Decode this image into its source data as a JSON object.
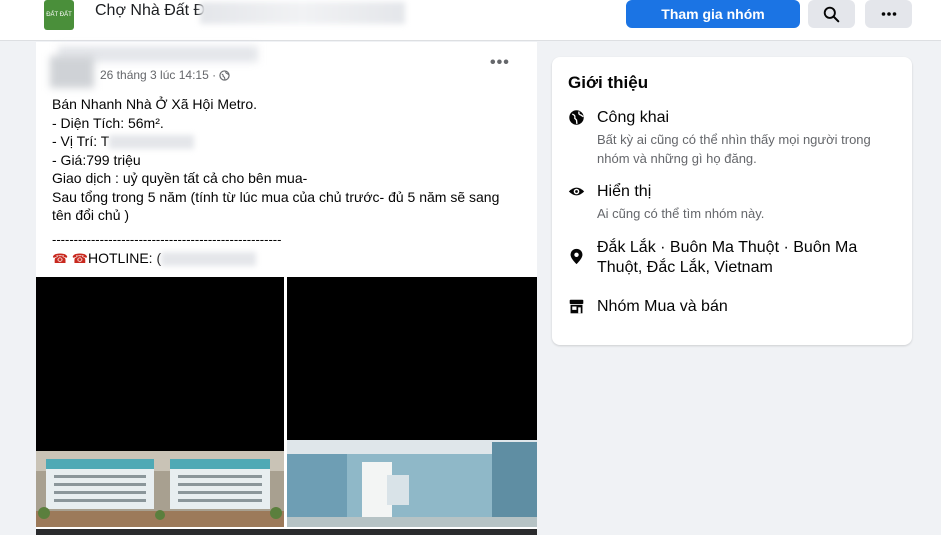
{
  "header": {
    "group_name": "Chợ Nhà Đất Đ",
    "logo_text": "ĐẤT ĐẤT",
    "join_label": "Tham gia nhóm",
    "search_icon": "search-icon",
    "more_icon": "more-horizontal-icon"
  },
  "post": {
    "timestamp": "26 tháng 3 lúc 14:15 ·",
    "privacy_icon": "globe-icon",
    "more_label": "•••",
    "lines": {
      "l1": "Bán Nhanh Nhà Ở Xã Hội Metro.",
      "l2": "- Diện Tích: 56m².",
      "l3": "- Vị Trí: T",
      "l4": "- Giá:799 triệu",
      "l5": "Giao dịch : uỷ quyền tất cả cho bên mua-",
      "l6": "Sau tổng trong 5 năm (tính từ lúc mua của chủ trước- đủ 5 năm sẽ sang tên đổi chủ )",
      "l7": "-----------------------------------------------------",
      "l8_icons": "☎ ☎",
      "l8": "HOTLINE: ("
    }
  },
  "about": {
    "title": "Giới thiệu",
    "rows": [
      {
        "icon": "globe-icon",
        "heading": "Công khai",
        "sub": "Bất kỳ ai cũng có thể nhìn thấy mọi người trong nhóm và những gì họ đăng."
      },
      {
        "icon": "eye-icon",
        "heading": "Hiển thị",
        "sub": "Ai cũng có thể tìm nhóm này."
      },
      {
        "icon": "location-pin-icon",
        "heading": "Đắk Lắk · Buôn Ma Thuột · Buôn Ma Thuột, Đắc Lắk, Vietnam",
        "sub": ""
      },
      {
        "icon": "shop-icon",
        "heading": "Nhóm Mua và bán",
        "sub": ""
      }
    ]
  },
  "colors": {
    "accent": "#1b74e4",
    "background": "#f0f2f5",
    "secondary_text": "#65676b"
  }
}
